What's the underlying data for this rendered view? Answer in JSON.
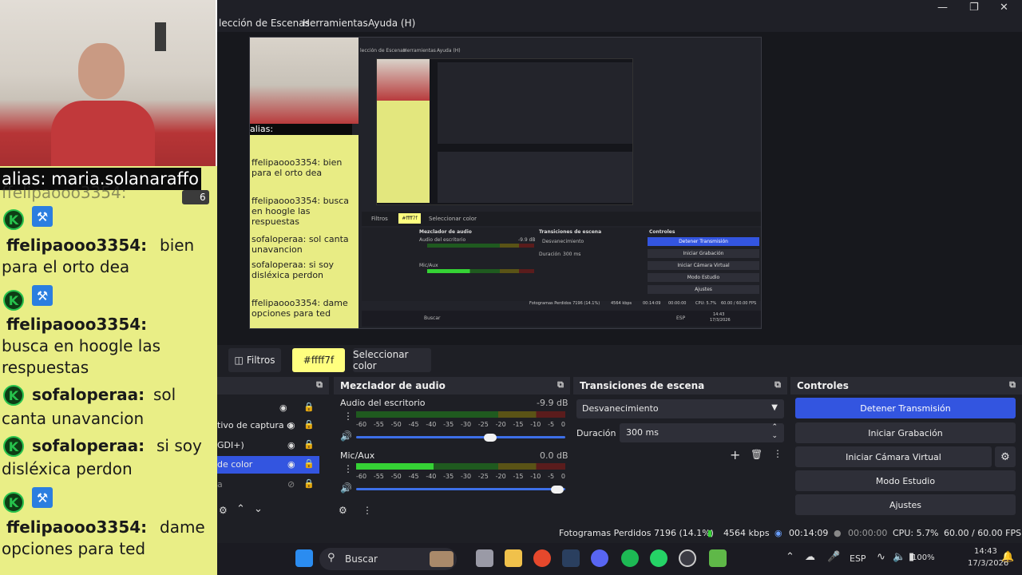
{
  "menu": {
    "items": [
      "lección de Escenas",
      "Herramientas",
      "Ayuda (H)"
    ]
  },
  "overlay": {
    "alias": "alias: maria.solanaraffo",
    "alias_cut": "ffelipaooo3354:",
    "count": "6",
    "chat": [
      {
        "user": "ffelipaooo3354:",
        "text": "bien",
        "cont": "para el orto dea"
      },
      {
        "user": "ffelipaooo3354:",
        "text": "",
        "cont": "busca en hoogle las",
        "cont2": "respuestas"
      },
      {
        "user": "sofaloperaa:",
        "text": "sol",
        "cont": "canta unavancion"
      },
      {
        "user": "sofaloperaa:",
        "text": "si soy",
        "cont": "disléxica perdon"
      },
      {
        "user": "ffelipaooo3354:",
        "text": "dame",
        "cont": "opciones para ted"
      }
    ]
  },
  "nested": {
    "alias": "alias: maria.solanaraffo",
    "chat": [
      "ffelipaooo3354: bien para el orto dea",
      "ffelipaooo3354: busca en hoogle las respuestas",
      "sofaloperaa: sol canta unavancion",
      "sofaloperaa: si soy disléxica perdon",
      "ffelipaooo3354: dame opciones para ted"
    ],
    "menu": [
      "lección de Escenas",
      "Herramientas",
      "Ayuda (H)"
    ],
    "toolbar": [
      "Filtros",
      "#ffff7f",
      "Seleccionar color"
    ],
    "mixer_title": "Mezclador de audio",
    "transitions_title": "Transiciones de escena",
    "controls_title": "Controles",
    "desktop_audio": "Audio del escritorio",
    "mic": "Mic/Aux",
    "desktop_db": "-9.9 dB",
    "transition": "Desvanecimiento",
    "duration_label": "Duración",
    "duration": "300 ms",
    "controls": [
      "Detener Transmisión",
      "Iniciar Grabación",
      "Iniciar Cámara Virtual",
      "Modo Estudio",
      "Ajustes"
    ],
    "status": [
      "Fotogramas Perdidos 7196 (14.1%)",
      "4564 kbps",
      "00:14:09",
      "00:00:00",
      "CPU: 5.7%",
      "60.00 / 60.00 FPS"
    ],
    "search": "Buscar",
    "lang": "ESP",
    "time": "14:43",
    "date": "17/3/2026"
  },
  "toolbar": {
    "filters": "Filtros",
    "color_value": "#ffff7f",
    "select_color": "Seleccionar color"
  },
  "sources": {
    "items": [
      "tivo de captura c",
      "GDI+)",
      "de color",
      "a"
    ]
  },
  "mixer": {
    "title": "Mezclador de audio",
    "channels": [
      {
        "name": "Audio del escritorio",
        "db": "-9.9 dB",
        "level": 0.68
      },
      {
        "name": "Mic/Aux",
        "db": "0.0 dB",
        "level": 0.37
      }
    ],
    "scale": [
      "-60",
      "-55",
      "-50",
      "-45",
      "-40",
      "-35",
      "-30",
      "-25",
      "-20",
      "-15",
      "-10",
      "-5",
      "0"
    ]
  },
  "transitions": {
    "title": "Transiciones de escena",
    "selected": "Desvanecimiento",
    "duration_label": "Duración",
    "duration": "300 ms"
  },
  "controls": {
    "title": "Controles",
    "stop_stream": "Detener Transmisión",
    "start_rec": "Iniciar Grabación",
    "virtual_cam": "Iniciar Cámara Virtual",
    "studio": "Modo Estudio",
    "settings": "Ajustes"
  },
  "status": {
    "dropped": "Fotogramas Perdidos 7196 (14.1%)",
    "kbps": "4564 kbps",
    "stream_time": "00:14:09",
    "rec_time": "00:00:00",
    "cpu": "CPU: 5.7%",
    "fps": "60.00 / 60.00 FPS"
  },
  "taskbar": {
    "search": "Buscar",
    "battery": "100%",
    "lang": "ESP",
    "time": "14:43",
    "date": "17/3/2026"
  },
  "colors": {
    "accent": "#3355e0",
    "chat_bg": "#e9ee86",
    "kick_green": "#27c24c"
  }
}
